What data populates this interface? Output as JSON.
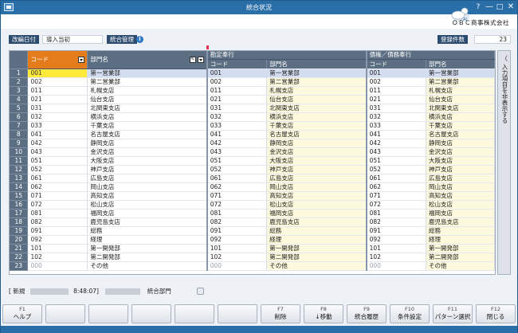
{
  "window": {
    "title": "統合状況",
    "brand": "ＯＢＣ商事株式会社",
    "controls": {
      "help": "?",
      "min": "—",
      "max": "□",
      "close": "✕"
    }
  },
  "filters": {
    "revision_date_label": "改編日付",
    "revision_date_value": "導入当初",
    "integration_label": "統合管理",
    "record_count_label": "登録件数",
    "record_count_value": "23"
  },
  "table": {
    "group_headers": [
      "勘定奉行",
      "債権／債務奉行"
    ],
    "col_code": "コード",
    "col_name": "部門名",
    "rows": [
      {
        "n": "1",
        "code": "001",
        "name": "第一営業部"
      },
      {
        "n": "2",
        "code": "002",
        "name": "第二営業部"
      },
      {
        "n": "3",
        "code": "011",
        "name": "札幌支店"
      },
      {
        "n": "4",
        "code": "021",
        "name": "仙台支店"
      },
      {
        "n": "5",
        "code": "031",
        "name": "北関東支店"
      },
      {
        "n": "6",
        "code": "032",
        "name": "横浜支店"
      },
      {
        "n": "7",
        "code": "033",
        "name": "千葉支店"
      },
      {
        "n": "8",
        "code": "041",
        "name": "名古屋支店"
      },
      {
        "n": "9",
        "code": "042",
        "name": "静岡支店"
      },
      {
        "n": "10",
        "code": "043",
        "name": "金沢支店"
      },
      {
        "n": "11",
        "code": "051",
        "name": "大阪支店"
      },
      {
        "n": "12",
        "code": "052",
        "name": "神戸支店"
      },
      {
        "n": "13",
        "code": "061",
        "name": "広島支店"
      },
      {
        "n": "14",
        "code": "062",
        "name": "岡山支店"
      },
      {
        "n": "15",
        "code": "071",
        "name": "高知支店"
      },
      {
        "n": "16",
        "code": "072",
        "name": "松山支店"
      },
      {
        "n": "17",
        "code": "081",
        "name": "福岡支店"
      },
      {
        "n": "18",
        "code": "082",
        "name": "鹿児島支店"
      },
      {
        "n": "19",
        "code": "091",
        "name": "総務"
      },
      {
        "n": "20",
        "code": "092",
        "name": "経理"
      },
      {
        "n": "21",
        "code": "101",
        "name": "第一開発部"
      },
      {
        "n": "22",
        "code": "102",
        "name": "第二開発部"
      },
      {
        "n": "23",
        "code": "000",
        "name": "その他"
      }
    ]
  },
  "side_panel": {
    "arrow": "〈",
    "label": "入力項目を非表示する"
  },
  "status": {
    "mode": "[ 新規",
    "time": "8:48:07]",
    "target": "統合部門"
  },
  "fkeys": [
    {
      "num": "F1",
      "label": "ヘルプ"
    },
    {
      "num": "",
      "label": ""
    },
    {
      "num": "",
      "label": ""
    },
    {
      "num": "",
      "label": ""
    },
    {
      "num": "",
      "label": ""
    },
    {
      "num": "",
      "label": ""
    },
    {
      "num": "F7",
      "label": "削除"
    },
    {
      "num": "F8",
      "label": "↓移動"
    },
    {
      "num": "F9",
      "label": "統合履歴"
    },
    {
      "num": "F10",
      "label": "条件設定"
    },
    {
      "num": "F11",
      "label": "パターン選択"
    },
    {
      "num": "F12",
      "label": "閉じる"
    }
  ]
}
